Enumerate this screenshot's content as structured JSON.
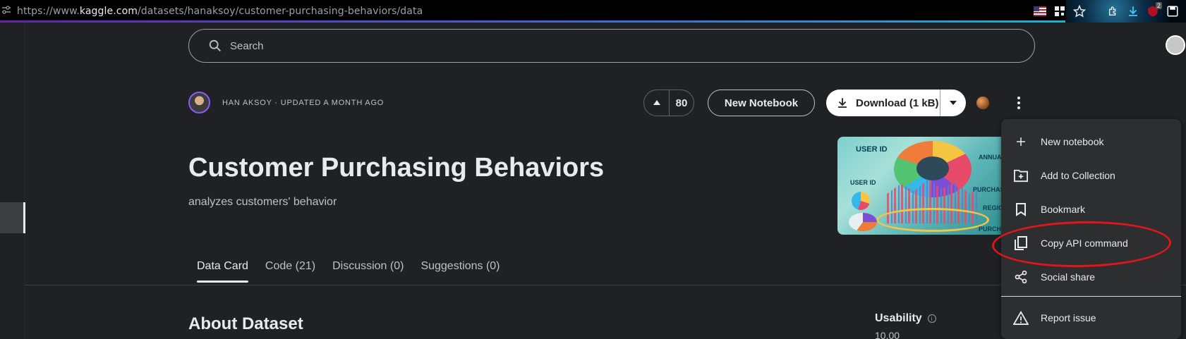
{
  "browser": {
    "url_prefix": "https://www.",
    "url_domain": "kaggle.com",
    "url_path": "/datasets/hanaksoy/customer-purchasing-behaviors/data",
    "extension_badge": "2"
  },
  "search": {
    "placeholder": "Search"
  },
  "author": {
    "line": "HAN AKSOY · UPDATED A MONTH AGO"
  },
  "actions": {
    "vote_count": "80",
    "new_notebook": "New Notebook",
    "download": "Download (1 kB)"
  },
  "dataset": {
    "title": "Customer Purchasing Behaviors",
    "subtitle": "analyzes customers' behavior"
  },
  "thumbnail": {
    "labels": [
      "USER ID",
      "USER ID",
      "ANNUAL",
      "PURCHASE",
      "REGION",
      "PURCH"
    ]
  },
  "tabs": [
    {
      "label": "Data Card",
      "active": true
    },
    {
      "label": "Code (21)",
      "active": false
    },
    {
      "label": "Discussion (0)",
      "active": false
    },
    {
      "label": "Suggestions (0)",
      "active": false
    }
  ],
  "about": {
    "heading": "About Dataset"
  },
  "usability": {
    "label": "Usability",
    "value": "10.00"
  },
  "menu": {
    "items": [
      {
        "label": "New notebook",
        "icon": "plus-icon"
      },
      {
        "label": "Add to Collection",
        "icon": "folder-plus-icon"
      },
      {
        "label": "Bookmark",
        "icon": "bookmark-icon"
      },
      {
        "label": "Copy API command",
        "icon": "copy-icon"
      },
      {
        "label": "Social share",
        "icon": "share-icon"
      },
      {
        "label": "Report issue",
        "icon": "warning-icon"
      }
    ]
  },
  "colors": {
    "background": "#202124",
    "text": "#e8eaed",
    "muted": "#bdc1c6",
    "menu_bg": "#2d2e30",
    "annotation_ring": "#e2141c"
  }
}
